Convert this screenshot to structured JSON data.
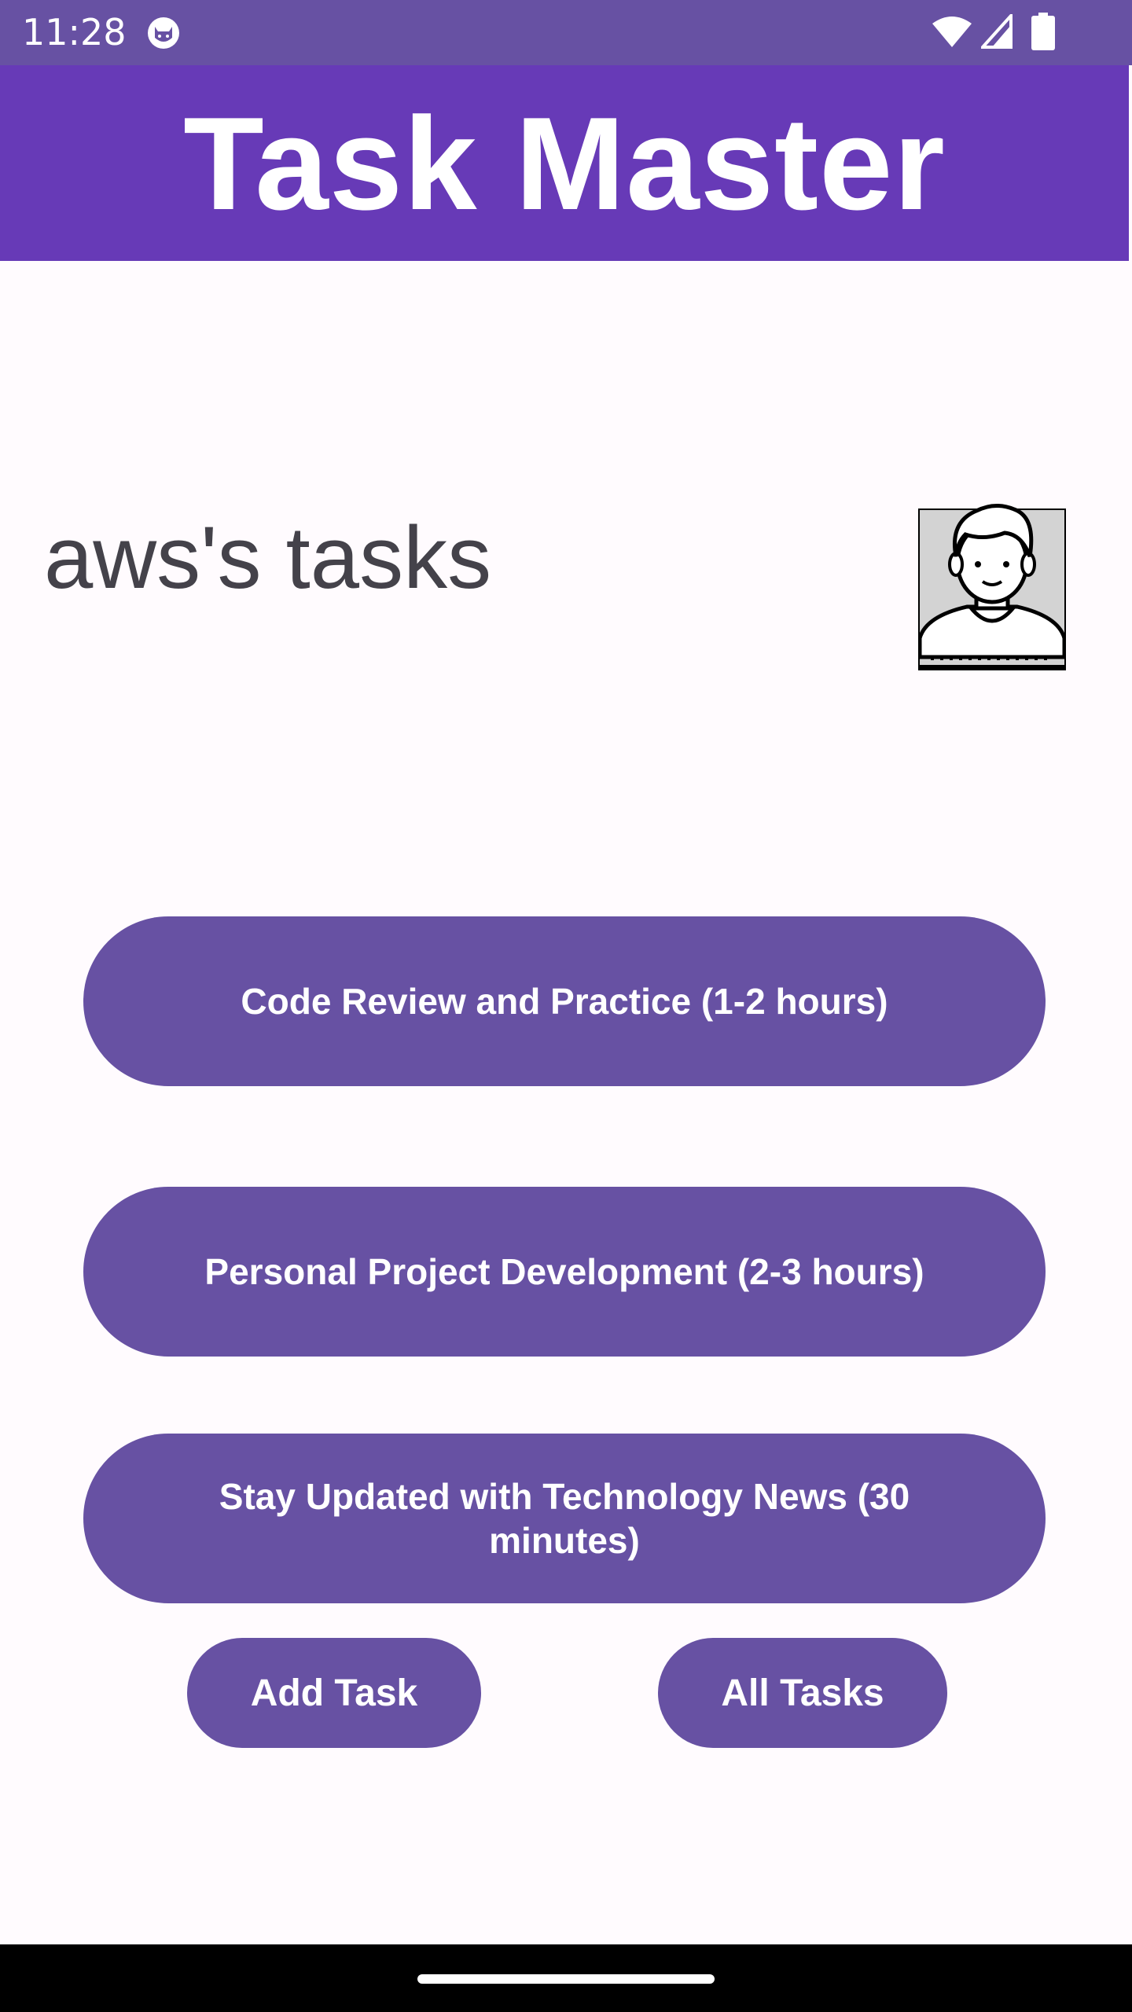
{
  "status_bar": {
    "time": "11:28",
    "icons": [
      "cat-app-icon",
      "wifi-icon",
      "cell-signal-icon",
      "battery-icon"
    ]
  },
  "app_bar": {
    "title": "Task Master"
  },
  "main": {
    "heading": "aws's tasks",
    "avatar_icon": "user-avatar-icon",
    "tasks": [
      {
        "label": "Code Review and Practice (1-2 hours)"
      },
      {
        "label": "Personal Project Development (2-3 hours)"
      },
      {
        "label": "Stay Updated with Technology News (30 minutes)"
      }
    ],
    "add_task_label": "Add Task",
    "all_tasks_label": "All Tasks"
  },
  "colors": {
    "status_bar": "#6751A3",
    "app_bar": "#673AB7",
    "button": "#6751A3",
    "background": "#FFFBFE",
    "heading_text": "#44424A"
  }
}
